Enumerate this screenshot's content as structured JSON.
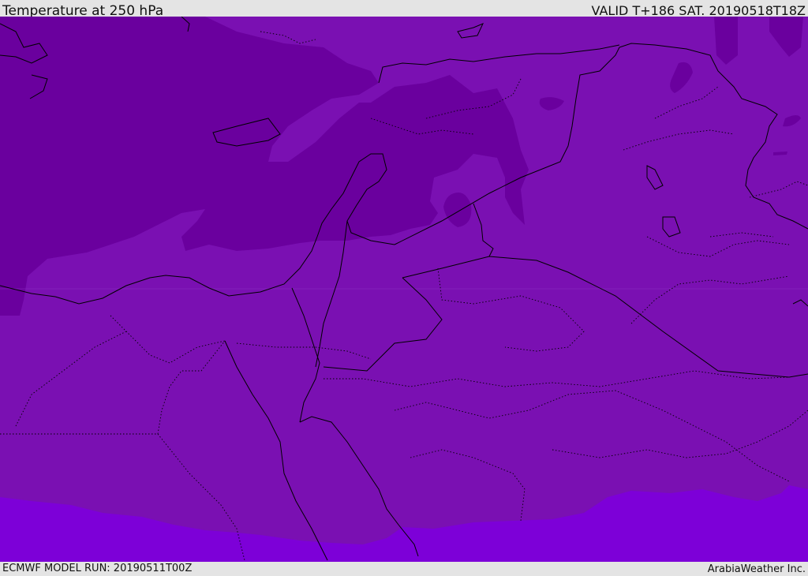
{
  "header": {
    "title": "Temperature at 250 hPa",
    "valid_time": "VALID T+186 SAT. 20190518T18Z"
  },
  "footer": {
    "model_run": "ECMWF MODEL RUN: 20190511T00Z",
    "credit": "ArabiaWeather Inc."
  },
  "map": {
    "colors": {
      "cold_band": "#6a009e",
      "main_band": "#7a10b2",
      "warm_band": "#7d00d8",
      "border_line": "#000000"
    }
  }
}
